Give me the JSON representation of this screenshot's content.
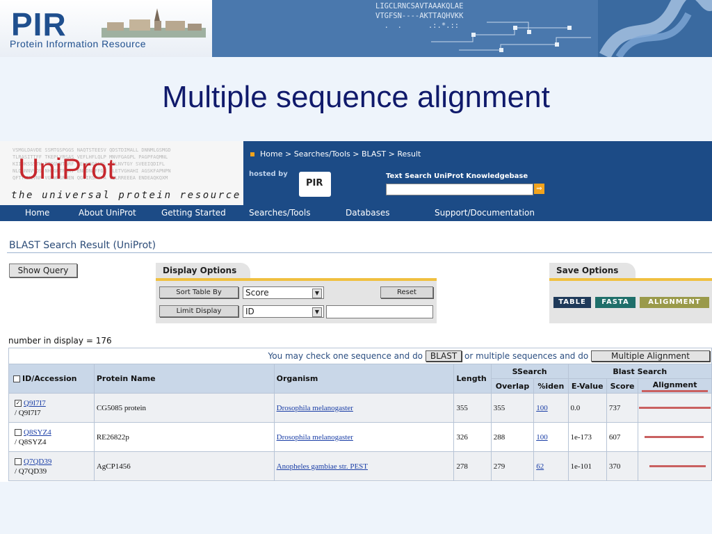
{
  "slide": {
    "title": "Multiple sequence alignment",
    "pir_logo": "PIR",
    "pir_subtitle": "Protein Information Resource",
    "seq_lines": [
      "LIGCLRNCSAVTAAAKQLAE",
      "VTGFSN----AKTTAQHVKK",
      "  .  .      .:.*.::"
    ]
  },
  "uniprot": {
    "logo": "UniProt",
    "tagline": "the universal protein resource",
    "seq_background": [
      "VSMGLDAVDE SSMTGSPGGS NAQTSTEESV QDSTDIMALL DNNMLGSMGD",
      "TLRASITTFF TKEPLYRSAS VEFLHFLQLP MNVFGAGPL PAGPFAQMNL",
      "KIIDKSSSTW PTGGWVTGRF AELHGQALNL SILNVTGY SVEEIQDIFL",
      "NLQGNNVVDS NHRGRTFNAV ENKDNAFFGT GLETVGHAHI AGSKFAPNPN",
      "QFTTWMLVNF VGWWHSRWEN QGVIRSRVFA TQLRREEEA ENDEAQKQXM"
    ],
    "breadcrumb": "Home > Searches/Tools > BLAST > Result",
    "hosted_by": "hosted by",
    "hosted_logo": "PIR",
    "text_search_label": "Text Search UniProt Knowledgebase",
    "text_search_value": "",
    "go_glyph": "⇒"
  },
  "nav": [
    "Home",
    "About UniProt",
    "Getting Started",
    "Searches/Tools",
    "Databases",
    "Support/Documentation"
  ],
  "page_heading": "BLAST Search Result (UniProt)",
  "show_query_label": "Show Query",
  "display_options": {
    "title": "Display Options",
    "sort_label": "Sort Table By",
    "sort_value": "Score",
    "limit_label": "Limit Display",
    "limit_value": "ID",
    "limit_text": "",
    "reset_label": "Reset"
  },
  "save_options": {
    "title": "Save Options",
    "table_label": "TABLE",
    "fasta_label": "FASTA",
    "alignment_label": "ALIGNMENT"
  },
  "count_text": "number in display = 176",
  "message": {
    "part1": "You may check one sequence and do",
    "blast_btn": "BLAST",
    "part2": "or multiple sequences and do",
    "multi_btn": "Multiple Alignment"
  },
  "table": {
    "headers": {
      "id": "ID/Accession",
      "protein": "Protein Name",
      "organism": "Organism",
      "length": "Length",
      "ssearch": "SSearch",
      "blast": "Blast Search",
      "overlap": "Overlap",
      "iden": "%iden",
      "evalue": "E-Value",
      "score": "Score",
      "alignment": "Alignment"
    },
    "rows": [
      {
        "id": "Q9I7I7",
        "acc": "/ Q9I7I7",
        "checked": true,
        "protein": "CG5085 protein",
        "organism": "Drosophila melanogaster",
        "length": "355",
        "overlap": "355",
        "iden": "100",
        "evalue": "0.0",
        "score": "737",
        "align_start": 0.0,
        "align_end": 1.0
      },
      {
        "id": "Q8SYZ4",
        "acc": "/ Q8SYZ4",
        "checked": false,
        "protein": "RE26822p",
        "organism": "Drosophila melanogaster",
        "length": "326",
        "overlap": "288",
        "iden": "100",
        "evalue": "1e-173",
        "score": "607",
        "align_start": 0.08,
        "align_end": 0.9
      },
      {
        "id": "Q7QD39",
        "acc": "/ Q7QD39",
        "checked": false,
        "protein": "AgCP1456",
        "organism": "Anopheles gambiae str. PEST",
        "length": "278",
        "overlap": "279",
        "iden": "62",
        "evalue": "1e-101",
        "score": "370",
        "align_start": 0.14,
        "align_end": 0.93
      }
    ]
  },
  "colors": {
    "uniprot_blue": "#1c4b86",
    "uniprot_red": "#c6272d",
    "title_navy": "#101a6b",
    "align_bar": "#c96060",
    "save_dark": "#1f3a5a",
    "save_teal": "#1f6f6a",
    "save_olive": "#9a9a4a"
  }
}
